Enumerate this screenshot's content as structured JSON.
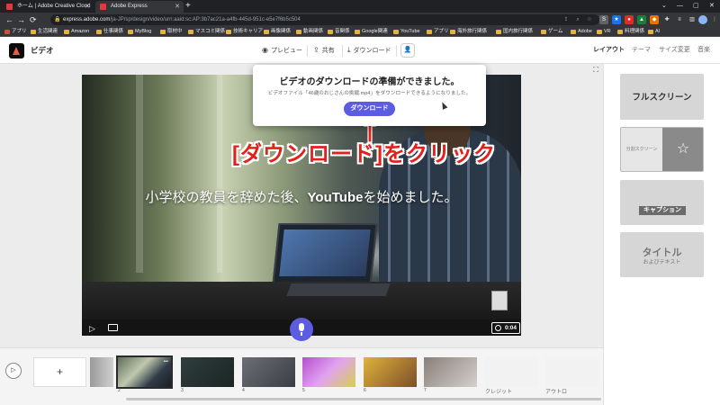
{
  "browser": {
    "tabs": [
      {
        "title": "ホーム | Adobe Creative Cloud",
        "active": false,
        "favicon_color": "#e03a3e"
      },
      {
        "title": "Adobe Express",
        "active": true,
        "favicon_color": "#e03a3e"
      }
    ],
    "new_tab": "+",
    "window_controls": {
      "tab_search": "⌄",
      "minimize": "—",
      "maximize": "▢",
      "close": "✕"
    },
    "url_domain": "express.adobe.com",
    "url_path": "/ja-JP/sp/design/video/urn:aaid:sc:AP:3b7ac21a-a4fb-445d-951c-e5e7f6b5c504",
    "nav": {
      "back": "←",
      "forward": "→",
      "reload": "⟳"
    },
    "bookmarks": [
      "アプリ",
      "生活関連",
      "Amazon",
      "仕事関係",
      "MyBlog",
      "取材中",
      "マスコミ関係",
      "技術キャリア",
      "画像関係",
      "動画関係",
      "音関係",
      "Google関連",
      "YouTube",
      "アプリ",
      "海外旅行関係",
      "国内旅行関係",
      "ゲーム",
      "Adobe",
      "VR",
      "料理関係",
      "AI"
    ]
  },
  "app": {
    "name": "ビデオ",
    "header": {
      "preview": "プレビュー",
      "share": "共有",
      "download": "ダウンロード"
    },
    "right_tabs": [
      "レイアウト",
      "テーマ",
      "サイズ変更",
      "音楽"
    ]
  },
  "popup": {
    "title": "ビデオのダウンロードの準備ができました。",
    "description": "ビデオファイル「46歳のおじさんの挑戦.mp4」をダウンロードできるようになりました。",
    "button": "ダウンロード"
  },
  "annotation": "[ダウンロード]をクリック",
  "video": {
    "subtitle_pre": "小学校の教員を辞めた後、",
    "subtitle_bold": "YouTube",
    "subtitle_post": "を始めました。",
    "time": "0:04"
  },
  "layouts": {
    "fullscreen": "フルスクリーン",
    "split": "分割スクリーン",
    "caption": "キャプション",
    "title_big": "タイトル",
    "title_small": "およびテキスト"
  },
  "timeline": {
    "add": "+",
    "slides": [
      {
        "num": "",
        "selected": false
      },
      {
        "num": "2",
        "selected": true
      },
      {
        "num": "3",
        "selected": false
      },
      {
        "num": "4",
        "selected": false
      },
      {
        "num": "5",
        "selected": false
      },
      {
        "num": "6",
        "selected": false
      },
      {
        "num": "7",
        "selected": false
      },
      {
        "num": "",
        "selected": false,
        "label": "クレジット"
      },
      {
        "num": "",
        "selected": false,
        "label": "アウトロ"
      }
    ]
  },
  "colors": {
    "accent": "#5c5ce0",
    "annotation": "#e3201b"
  }
}
